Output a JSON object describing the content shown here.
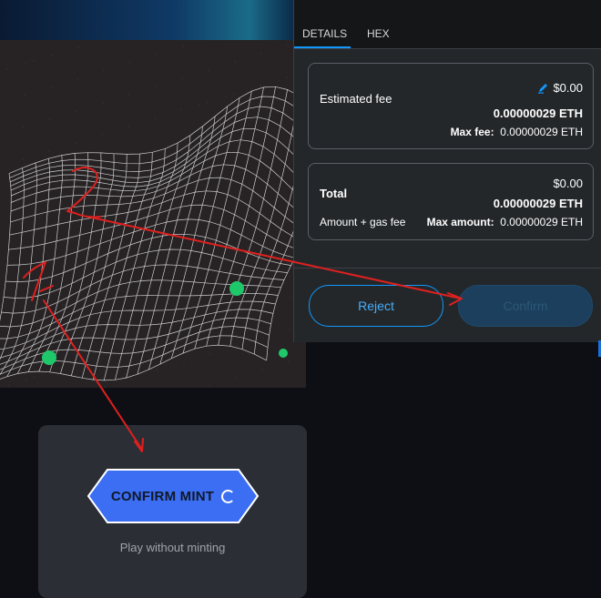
{
  "wallet": {
    "tabs": [
      {
        "label": "DETAILS"
      },
      {
        "label": "HEX"
      }
    ],
    "fee": {
      "label": "Estimated fee",
      "usd": "$0.00",
      "eth": "0.00000029 ETH",
      "max_label": "Max fee:",
      "max_value": "0.00000029 ETH"
    },
    "total": {
      "label": "Total",
      "sub_label": "Amount + gas fee",
      "usd": "$0.00",
      "eth": "0.00000029 ETH",
      "max_label": "Max amount:",
      "max_value": "0.00000029 ETH"
    },
    "buttons": {
      "reject": "Reject",
      "confirm": "Confirm"
    }
  },
  "mint": {
    "button_label": "CONFIRM MINT",
    "play_link": "Play without minting"
  },
  "annotations": {
    "mark_1": "1",
    "mark_2": "2"
  },
  "colors": {
    "accent": "#1098fc",
    "mint_button": "#3b6ef2",
    "annotation": "#e0201f",
    "art_dot": "#1ec86a"
  }
}
